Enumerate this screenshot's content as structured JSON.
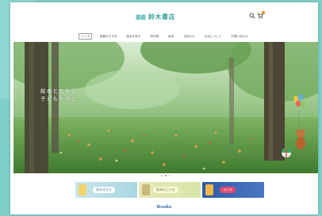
{
  "brand": {
    "name": "鈴木書店",
    "accent": "#3fa3a0"
  },
  "header": {
    "icons": [
      "search-icon",
      "cart-icon"
    ],
    "cart_badge_color": "#e8872c"
  },
  "nav": {
    "items": [
      {
        "label": "トップ",
        "active": true
      },
      {
        "label": "新着おすすめ"
      },
      {
        "label": "絵本を探す"
      },
      {
        "label": "読み物"
      },
      {
        "label": "絵本"
      },
      {
        "label": "お知らせ"
      },
      {
        "label": "お店について"
      },
      {
        "label": "お問い合わせ"
      }
    ]
  },
  "hero": {
    "line1": "絵本とともに",
    "line2": "子どもたちに",
    "sub": "",
    "slide_count": 3,
    "active_slide": 1
  },
  "banners": [
    {
      "label": "読みきかせ"
    },
    {
      "label": "絵本のしらせ"
    },
    {
      "label": "ラジオ"
    }
  ],
  "section": {
    "title": "Books"
  }
}
